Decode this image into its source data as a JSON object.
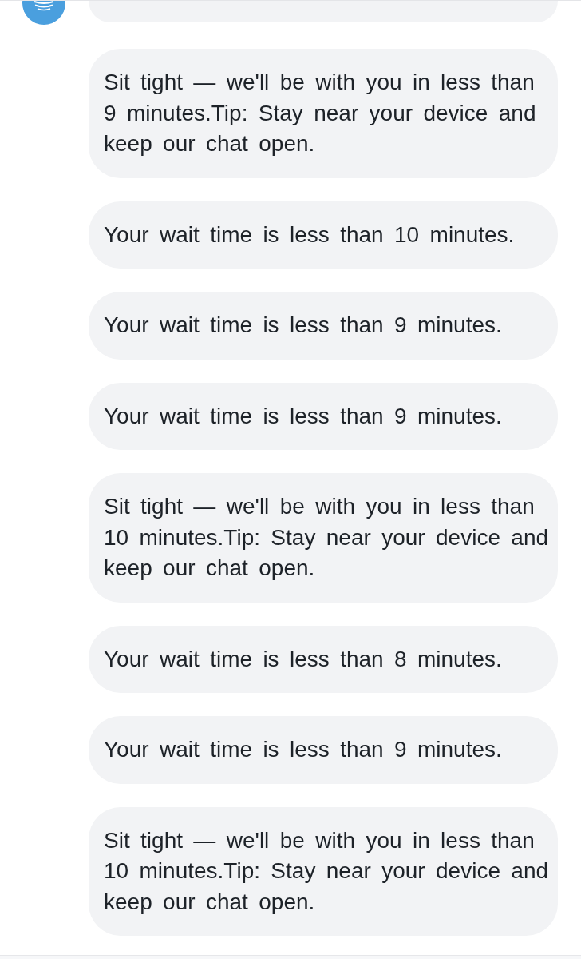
{
  "chat": {
    "messages": [
      {
        "text": "Sit tight — we'll be with you in less than 9 minutes.Tip: Stay near your device and keep our chat open."
      },
      {
        "text": "Your wait time is less than 10 minutes."
      },
      {
        "text": "Your wait time is less than 9 minutes."
      },
      {
        "text": "Your wait time is less than 9 minutes."
      },
      {
        "text": "Sit tight — we'll be with you in less than 10 minutes.Tip: Stay near your device and keep our chat open."
      },
      {
        "text": "Your wait time is less than 8 minutes."
      },
      {
        "text": "Your wait time is less than 9 minutes."
      },
      {
        "text": "Sit tight — we'll be with you in less than 10 minutes.Tip: Stay near your device and keep our chat open."
      }
    ]
  }
}
